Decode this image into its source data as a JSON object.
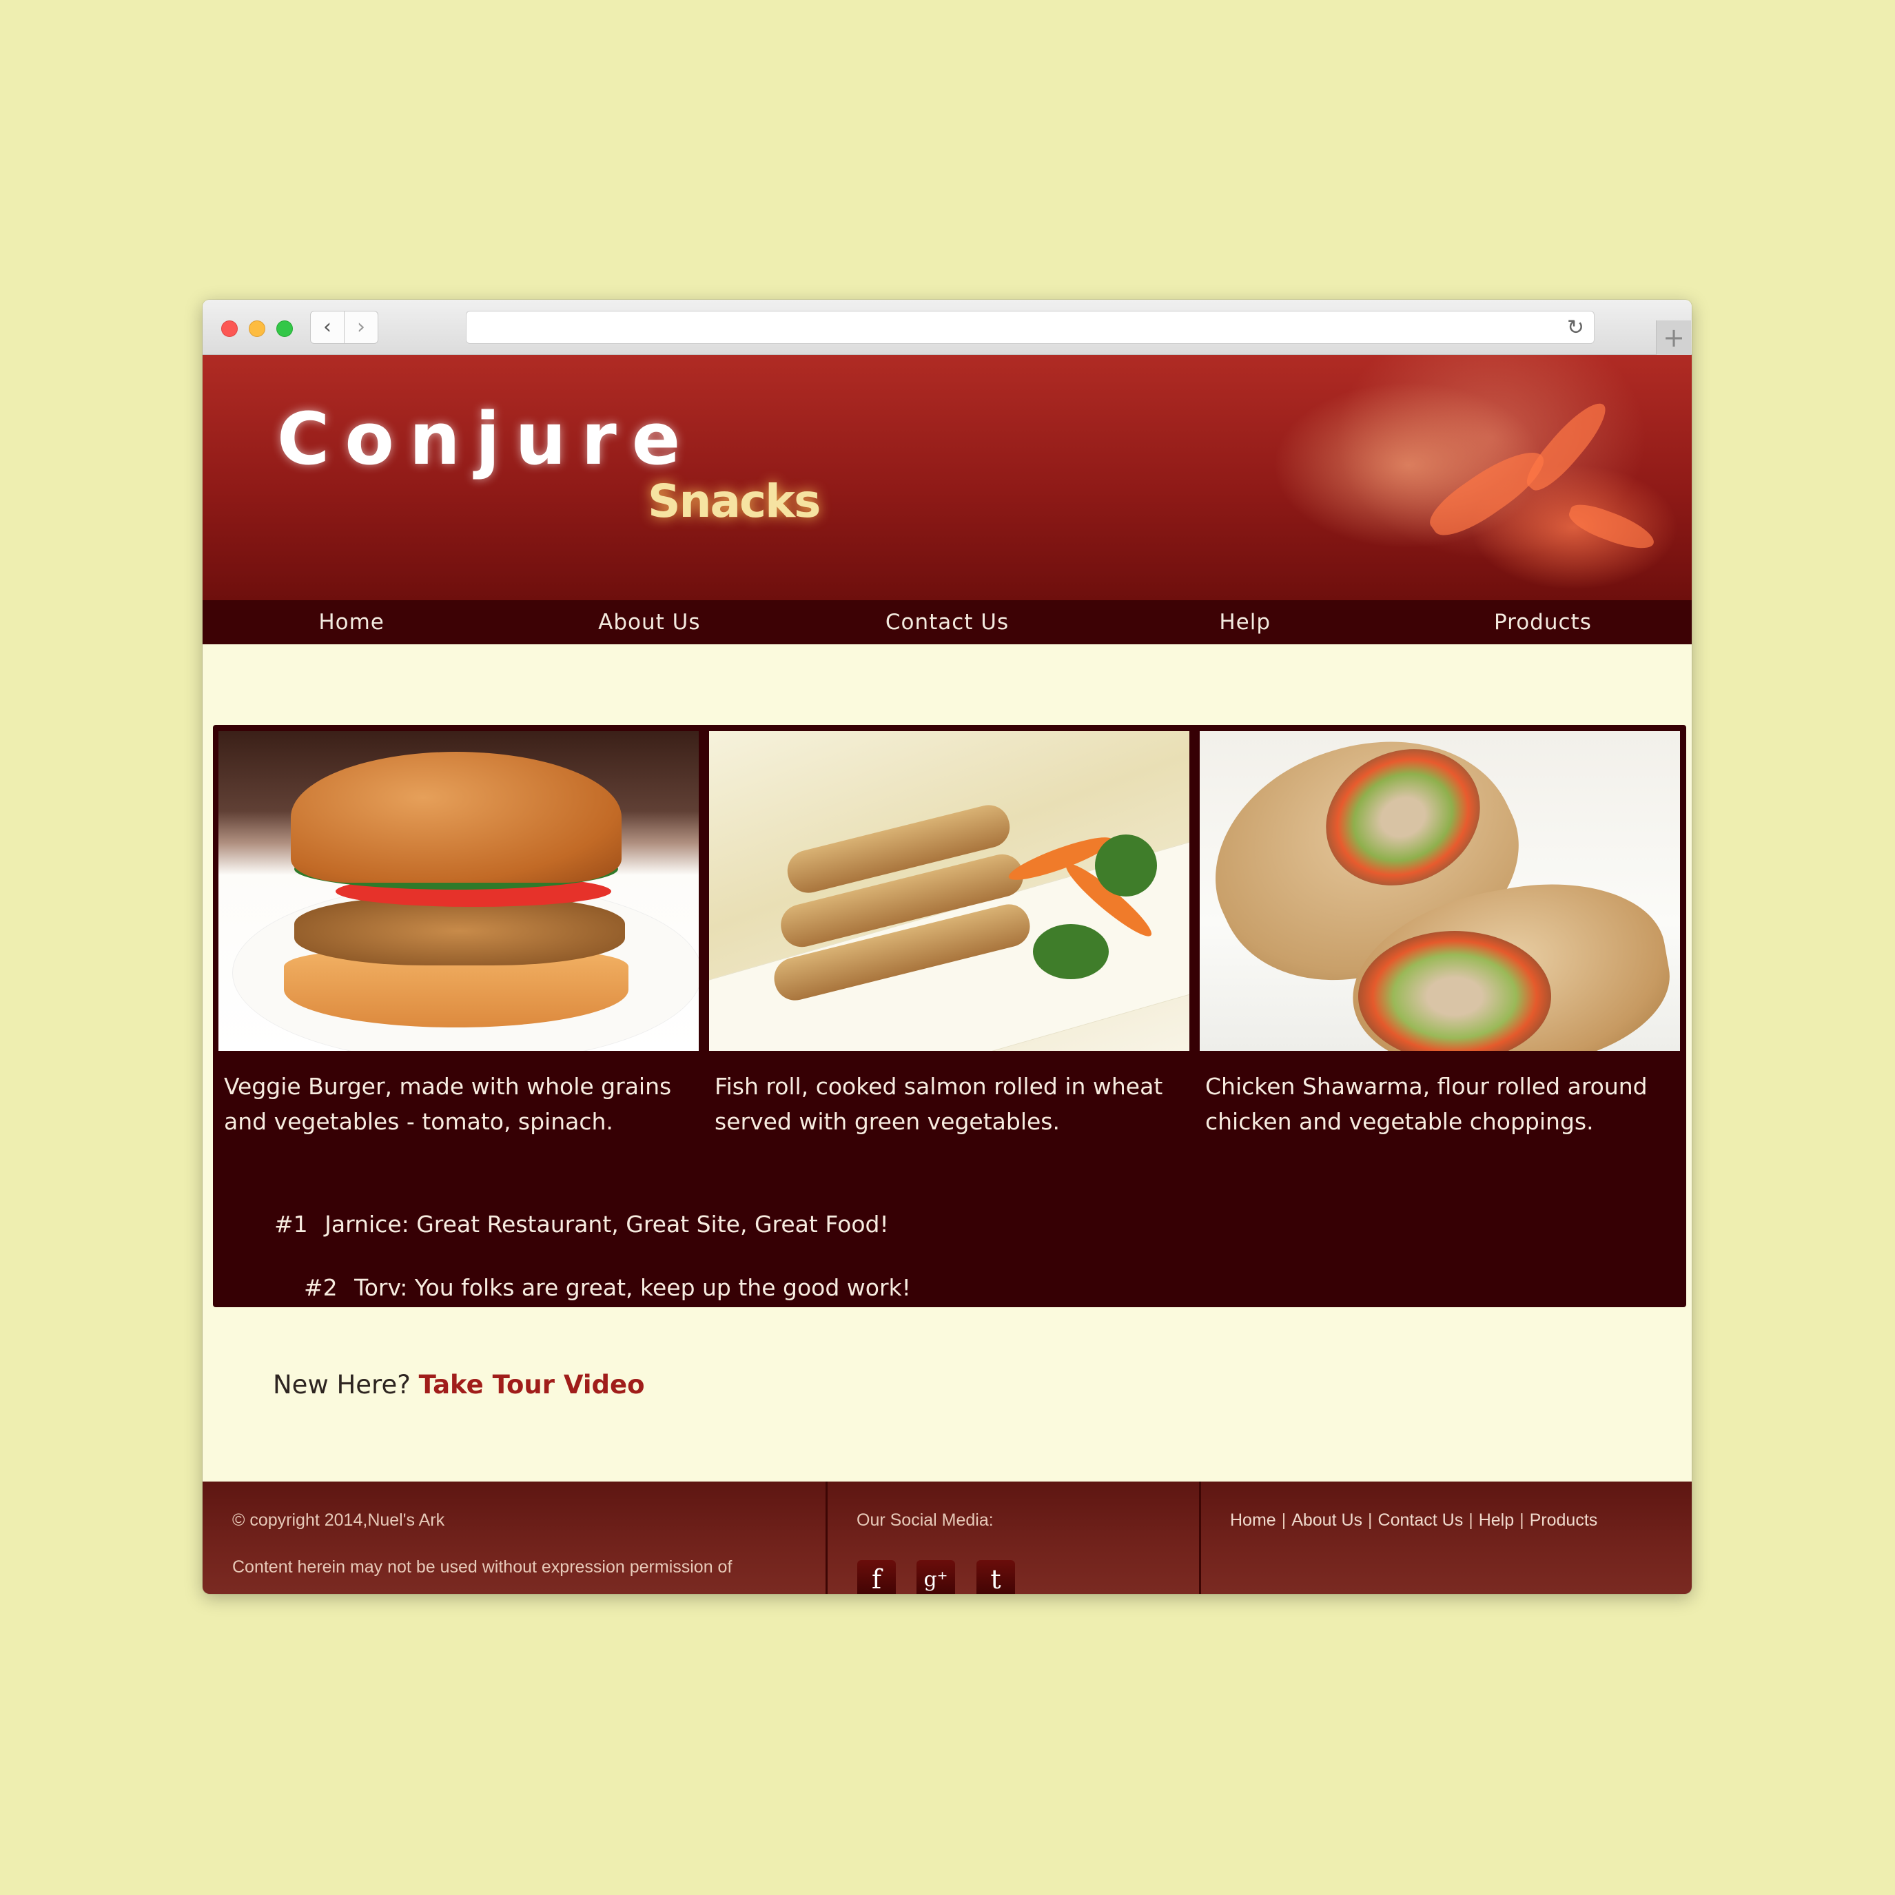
{
  "brand": {
    "name": "Conjure",
    "tagline": "Snacks",
    "name_color": "#ffffff",
    "tagline_color": "#f6e3a2"
  },
  "colors": {
    "page_background": "#eeeeb0",
    "header_red": "#8f1a17",
    "nav_background": "#3d0205",
    "panel_background": "#360004",
    "link_accent": "#a01d1a"
  },
  "browser": {
    "back_icon": "chevron-left",
    "forward_icon": "chevron-right",
    "reload_icon": "reload",
    "new_tab_icon": "plus",
    "url": ""
  },
  "nav": {
    "items": [
      {
        "label": "Home"
      },
      {
        "label": "About Us"
      },
      {
        "label": "Contact Us"
      },
      {
        "label": "Help"
      },
      {
        "label": "Products"
      }
    ]
  },
  "products": [
    {
      "caption": "Veggie Burger, made with whole grains and vegetables - tomato, spinach."
    },
    {
      "caption": "Fish roll, cooked salmon rolled in wheat served with green vegetables."
    },
    {
      "caption": "Chicken Shawarma, flour rolled around chicken and vegetable choppings."
    }
  ],
  "reviews": [
    {
      "rank": "#1",
      "text": "Jarnice: Great Restaurant, Great Site, Great Food!"
    },
    {
      "rank": "#2",
      "text": "Torv: You folks are great, keep up the good work!"
    }
  ],
  "cta": {
    "prompt": "New Here?",
    "link": "Take Tour Video"
  },
  "footer": {
    "copyright": "© copyright 2014,Nuel's Ark",
    "disclaimer": "Content herein may not be used without expression permission of",
    "social_label": "Our Social Media:",
    "social": [
      {
        "icon": "facebook-icon",
        "glyph": "f"
      },
      {
        "icon": "google-plus-icon",
        "glyph": "g⁺"
      },
      {
        "icon": "tumblr-icon",
        "glyph": "t"
      }
    ],
    "links": [
      "Home",
      "About Us",
      "Contact Us",
      "Help",
      "Products"
    ]
  }
}
